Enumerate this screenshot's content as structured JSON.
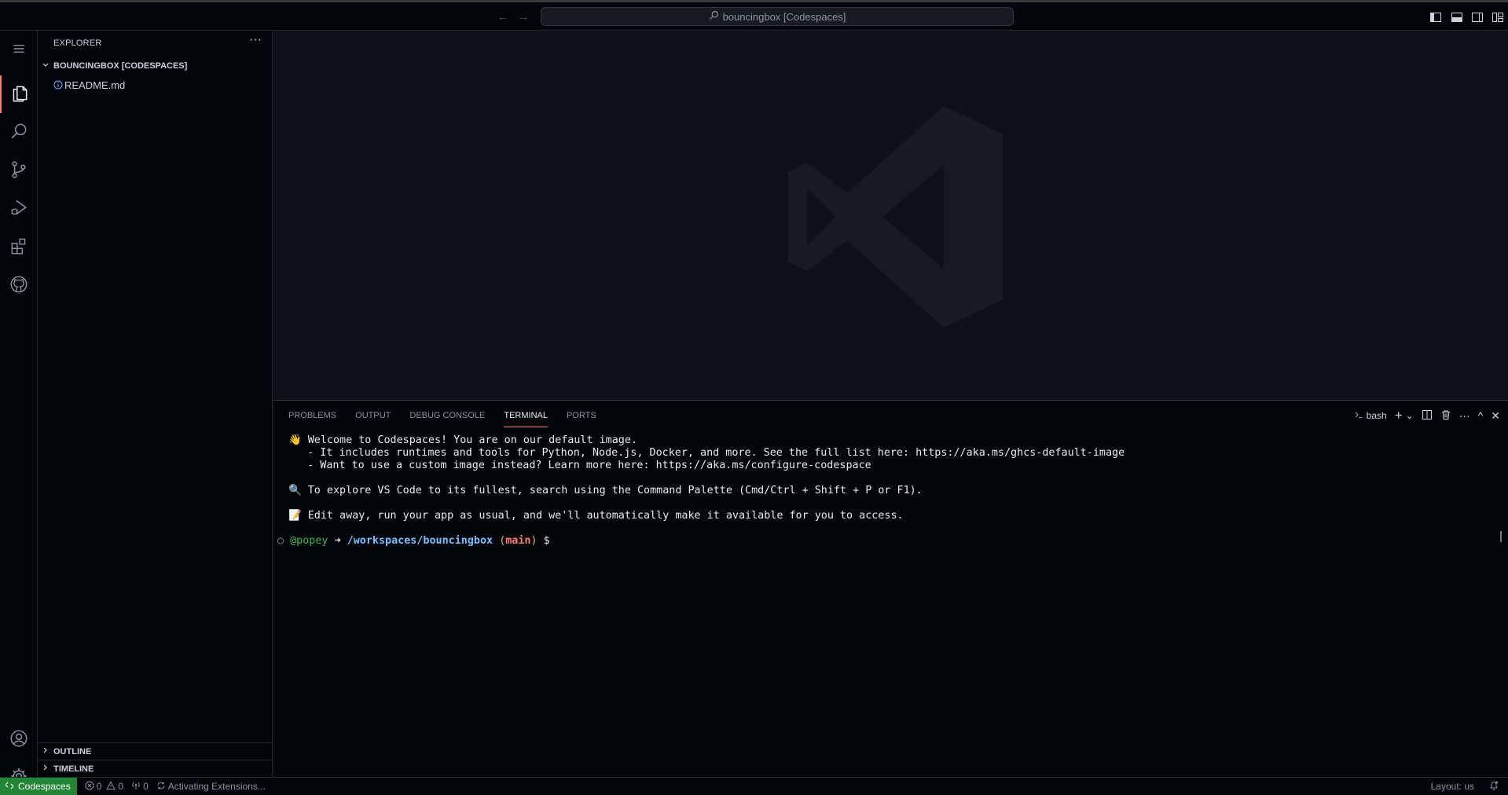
{
  "titlebar": {
    "back_label": "←",
    "forward_label": "→",
    "command_center_text": "bouncingbox [Codespaces]"
  },
  "sidebar": {
    "title": "EXPLORER",
    "more_label": "···",
    "workspace_name": "BOUNCINGBOX [CODESPACES]",
    "files": [
      {
        "name": "README.md",
        "icon": "info-icon"
      }
    ],
    "outline_label": "OUTLINE",
    "timeline_label": "TIMELINE"
  },
  "panel": {
    "tabs": [
      {
        "label": "PROBLEMS",
        "active": false
      },
      {
        "label": "OUTPUT",
        "active": false
      },
      {
        "label": "DEBUG CONSOLE",
        "active": false
      },
      {
        "label": "TERMINAL",
        "active": true
      },
      {
        "label": "PORTS",
        "active": false
      }
    ],
    "shell_label": "bash",
    "new_terminal_label": "+",
    "dropdown_label": "⌄",
    "more_label": "···",
    "maximize_label": "^",
    "close_label": "✕"
  },
  "terminal": {
    "line1_emoji": "👋",
    "line1": "Welcome to Codespaces! You are on our default image.",
    "line2": "   - It includes runtimes and tools for Python, Node.js, Docker, and more. See the full list here: https://aka.ms/ghcs-default-image",
    "line3": "   - Want to use a custom image instead? Learn more here: https://aka.ms/configure-codespace",
    "line4_emoji": "🔍",
    "line4": "To explore VS Code to its fullest, search using the Command Palette (Cmd/Ctrl + Shift + P or F1).",
    "line5_emoji": "📝",
    "line5": "Edit away, run your app as usual, and we'll automatically make it available for you to access.",
    "prompt_marker": "○",
    "prompt_user": "@popey",
    "prompt_arrow": "➜",
    "prompt_path": "/workspaces/bouncingbox",
    "prompt_open": "(",
    "prompt_branch": "main",
    "prompt_close": ")",
    "prompt_symbol": "$"
  },
  "statusbar": {
    "remote_label": "Codespaces",
    "errors": "0",
    "warnings": "0",
    "ports": "0",
    "activity": "Activating Extensions...",
    "layout": "Layout: us"
  },
  "colors": {
    "accent": "#f78166",
    "remote_bg": "#238636",
    "background": "#0d1117",
    "chrome": "#010409"
  }
}
